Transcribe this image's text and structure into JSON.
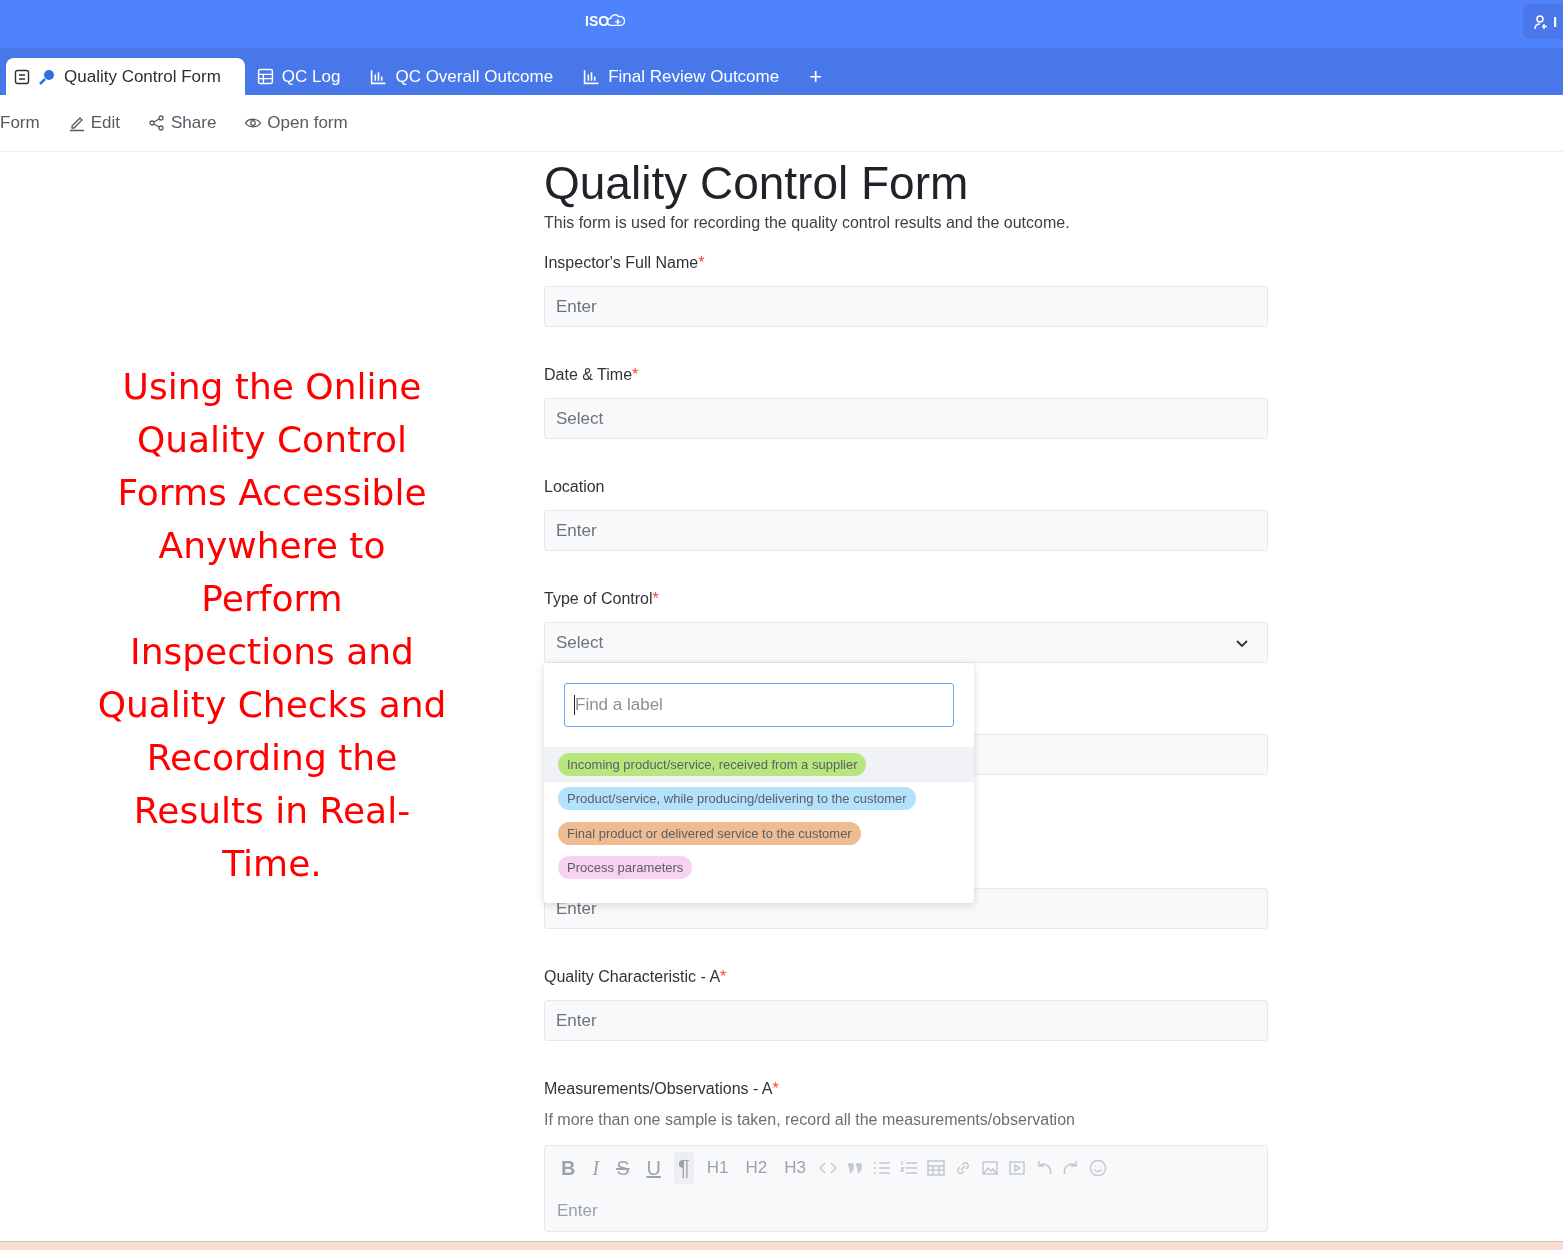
{
  "top_bar": {
    "logo": "ISO",
    "invite_button": "I"
  },
  "tabs": [
    {
      "label": "Quality Control Form",
      "kind": "form",
      "selected": true
    },
    {
      "label": "QC Log",
      "kind": "table",
      "selected": false
    },
    {
      "label": "QC Overall Outcome",
      "kind": "chart",
      "selected": false
    },
    {
      "label": "Final Review Outcome",
      "kind": "chart",
      "selected": false
    }
  ],
  "add_tab": "+",
  "actions": [
    {
      "label": "Form",
      "kind": "none"
    },
    {
      "label": "Edit",
      "kind": "edit"
    },
    {
      "label": "Share",
      "kind": "share"
    },
    {
      "label": "Open form",
      "kind": "eye"
    }
  ],
  "annotation": "Using the Online Quality Control Forms Accessible Anywhere to Perform Inspections and Quality Checks and Recording the Results in Real-Time.",
  "form": {
    "title": "Quality Control Form",
    "description": "This form is used for recording the quality control results and the outcome.",
    "fields": [
      {
        "kind": "input",
        "label": "Inspector's Full Name",
        "required_mark": "*",
        "placeholder": "Enter"
      },
      {
        "kind": "input",
        "label": "Date & Time",
        "required_mark": "*",
        "placeholder": "Select"
      },
      {
        "kind": "input",
        "label": "Location",
        "placeholder": "Enter"
      },
      {
        "kind": "dropdown",
        "label": "Type of Control",
        "required_mark": "*",
        "placeholder": "Select",
        "expanded": true
      },
      {
        "kind": "input"
      },
      {
        "kind": "input",
        "placeholder": "Enter"
      },
      {
        "kind": "input",
        "label": "Quality Characteristic - A",
        "required_mark": "*",
        "placeholder": "Enter"
      },
      {
        "kind": "richtext",
        "label": "Measurements/Observations - A",
        "required_mark": "*",
        "hint": "If more than one sample is taken, record all the measurements/observation",
        "placeholder": "Enter"
      }
    ]
  },
  "dropdown": {
    "search_placeholder": "Find a label",
    "options": [
      {
        "label": "Incoming product/service, received from a supplier",
        "color": "#b7e77c",
        "selected": true
      },
      {
        "label": "Product/service, while producing/delivering to the customer",
        "color": "#b4e2fb",
        "selected": false
      },
      {
        "label": "Final product or delivered service to the customer",
        "color": "#efbb90",
        "selected": false
      },
      {
        "label": "Process parameters",
        "color": "#f7d3f1",
        "selected": false
      }
    ]
  },
  "editor_toolbar": [
    {
      "label": "B",
      "kind": "bold",
      "selected": false
    },
    {
      "label": "I",
      "kind": "italic",
      "selected": false
    },
    {
      "label": "S",
      "kind": "strike",
      "selected": false
    },
    {
      "label": "U",
      "kind": "underline",
      "selected": false
    },
    {
      "label": "¶",
      "kind": "plain",
      "selected": true
    },
    {
      "label": "H1",
      "kind": "plain",
      "selected": false
    },
    {
      "label": "H2",
      "kind": "plain",
      "selected": false
    },
    {
      "label": "H3",
      "kind": "plain",
      "selected": false
    }
  ]
}
